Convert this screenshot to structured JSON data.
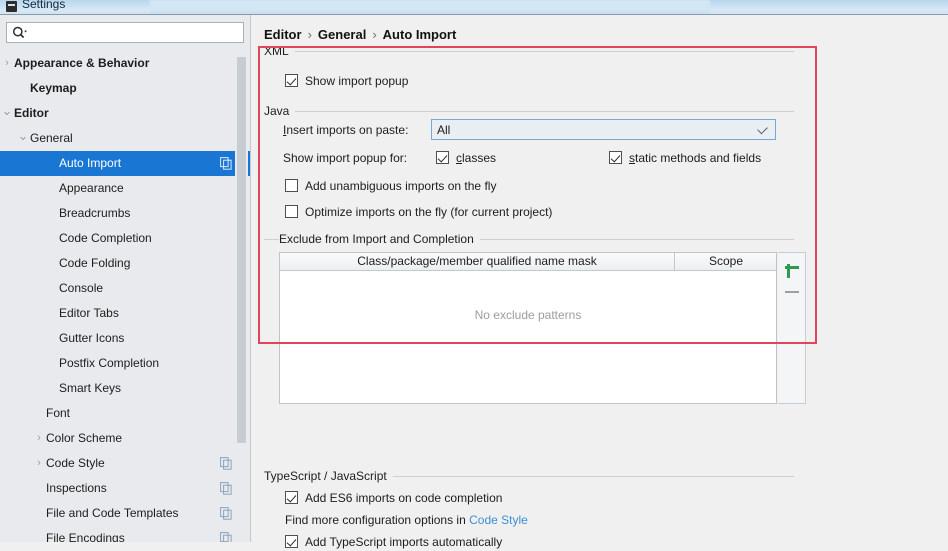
{
  "window": {
    "title": "Settings",
    "icon": "settings-window-icon"
  },
  "sidebar": {
    "search": {
      "value": "",
      "placeholder": "",
      "icon": "search-icon"
    },
    "items": [
      {
        "label": "Appearance & Behavior",
        "indent": 14,
        "arrow": "collapsed",
        "bold": true,
        "selected": false,
        "copy_icon": false
      },
      {
        "label": "Keymap",
        "indent": 30,
        "arrow": "none",
        "bold": true,
        "selected": false,
        "copy_icon": false
      },
      {
        "label": "Editor",
        "indent": 14,
        "arrow": "expanded",
        "bold": true,
        "selected": false,
        "copy_icon": false
      },
      {
        "label": "General",
        "indent": 30,
        "arrow": "expanded",
        "bold": false,
        "selected": false,
        "copy_icon": false
      },
      {
        "label": "Auto Import",
        "indent": 59,
        "arrow": "none",
        "bold": false,
        "selected": true,
        "copy_icon": true
      },
      {
        "label": "Appearance",
        "indent": 59,
        "arrow": "none",
        "bold": false,
        "selected": false,
        "copy_icon": false
      },
      {
        "label": "Breadcrumbs",
        "indent": 59,
        "arrow": "none",
        "bold": false,
        "selected": false,
        "copy_icon": false
      },
      {
        "label": "Code Completion",
        "indent": 59,
        "arrow": "none",
        "bold": false,
        "selected": false,
        "copy_icon": false
      },
      {
        "label": "Code Folding",
        "indent": 59,
        "arrow": "none",
        "bold": false,
        "selected": false,
        "copy_icon": false
      },
      {
        "label": "Console",
        "indent": 59,
        "arrow": "none",
        "bold": false,
        "selected": false,
        "copy_icon": false
      },
      {
        "label": "Editor Tabs",
        "indent": 59,
        "arrow": "none",
        "bold": false,
        "selected": false,
        "copy_icon": false
      },
      {
        "label": "Gutter Icons",
        "indent": 59,
        "arrow": "none",
        "bold": false,
        "selected": false,
        "copy_icon": false
      },
      {
        "label": "Postfix Completion",
        "indent": 59,
        "arrow": "none",
        "bold": false,
        "selected": false,
        "copy_icon": false
      },
      {
        "label": "Smart Keys",
        "indent": 59,
        "arrow": "none",
        "bold": false,
        "selected": false,
        "copy_icon": false
      },
      {
        "label": "Font",
        "indent": 46,
        "arrow": "none",
        "bold": false,
        "selected": false,
        "copy_icon": false
      },
      {
        "label": "Color Scheme",
        "indent": 46,
        "arrow": "collapsed",
        "bold": false,
        "selected": false,
        "copy_icon": false
      },
      {
        "label": "Code Style",
        "indent": 46,
        "arrow": "collapsed",
        "bold": false,
        "selected": false,
        "copy_icon": true
      },
      {
        "label": "Inspections",
        "indent": 46,
        "arrow": "none",
        "bold": false,
        "selected": false,
        "copy_icon": true
      },
      {
        "label": "File and Code Templates",
        "indent": 46,
        "arrow": "none",
        "bold": false,
        "selected": false,
        "copy_icon": true
      },
      {
        "label": "File Encodings",
        "indent": 46,
        "arrow": "none",
        "bold": false,
        "selected": false,
        "copy_icon": true
      }
    ]
  },
  "breadcrumb": {
    "part1": "Editor",
    "sep1": "›",
    "part2": "General",
    "sep2": "›",
    "part3": "Auto Import"
  },
  "main": {
    "groups": {
      "xml": "XML",
      "java": "Java",
      "exclude": "Exclude from Import and Completion",
      "ts_js": "TypeScript / JavaScript"
    },
    "xml": {
      "show_import_popup": {
        "label": "Show import popup",
        "checked": true
      }
    },
    "java": {
      "insert_imports_label": "Insert imports on paste:",
      "insert_imports_value": "All",
      "show_popup_for_label": "Show import popup for:",
      "classes": {
        "label": "classes",
        "checked": true
      },
      "static_methods": {
        "label": "static methods and fields",
        "checked": true
      },
      "add_unambiguous": {
        "label": "Add unambiguous imports on the fly",
        "checked": false
      },
      "optimize_imports": {
        "label": "Optimize imports on the fly (for current project)",
        "checked": false
      }
    },
    "exclude_table": {
      "col_mask": "Class/package/member qualified name mask",
      "col_scope": "Scope",
      "empty_text": "No exclude patterns",
      "rows": [],
      "add_button": "add-row-button",
      "remove_button": "remove-row-button"
    },
    "tsjs": {
      "add_es6": {
        "label": "Add ES6 imports on code completion",
        "checked": true
      },
      "hint_prefix": "Find more configuration options in",
      "hint_link": "Code Style",
      "add_ts": {
        "label": "Add TypeScript imports automatically",
        "checked": true
      }
    }
  },
  "annotation": {
    "color": "#e0455b"
  },
  "colors": {
    "selection": "#1977d3",
    "link": "#3b8fd6",
    "add_green": "#2e9b4f",
    "muted": "#9d9d9d"
  }
}
